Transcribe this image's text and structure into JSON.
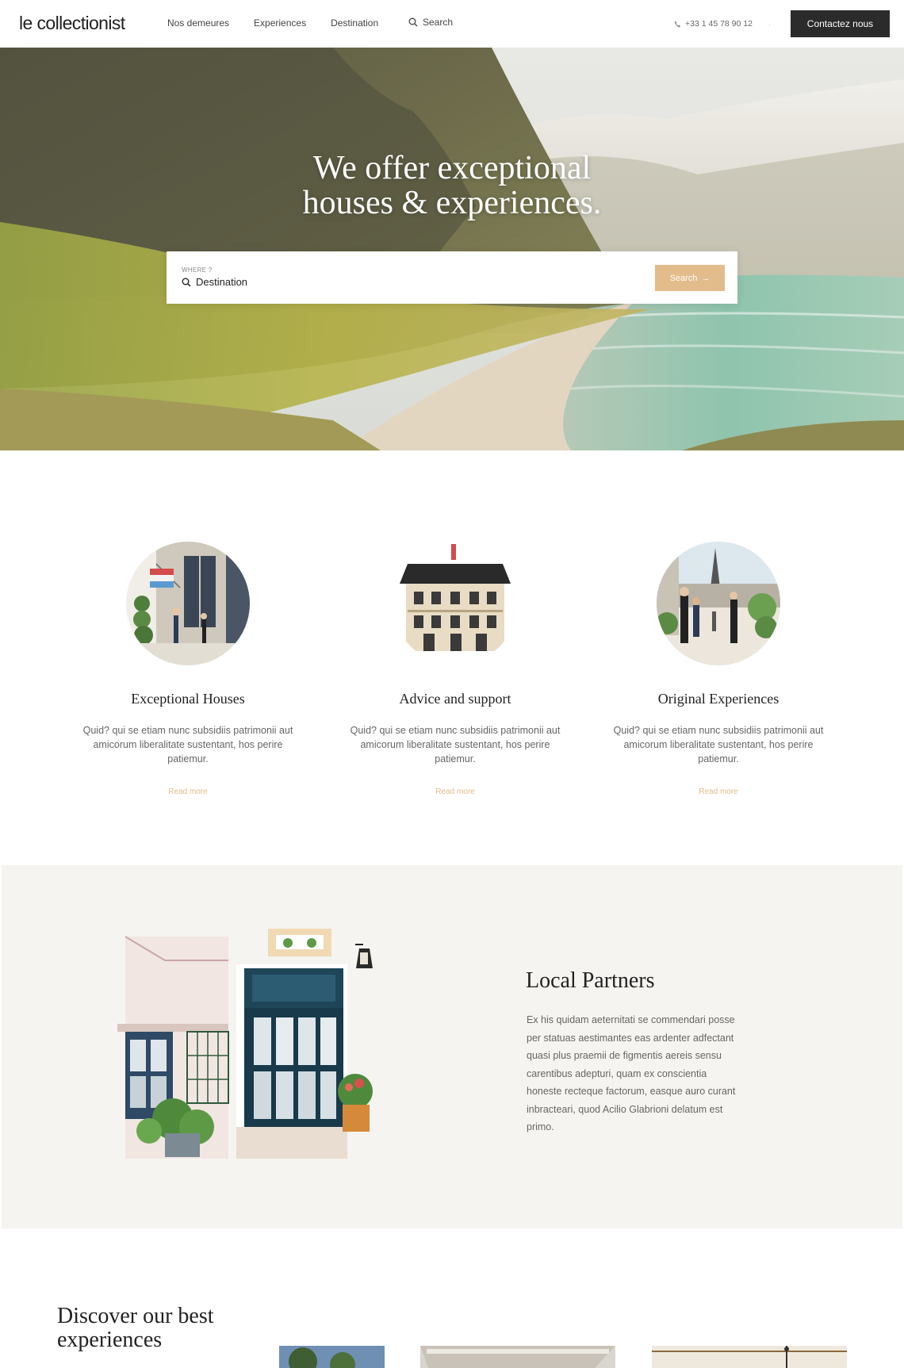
{
  "header": {
    "logo": "le collectionist",
    "nav": [
      "Nos demeures",
      "Experiences",
      "Destination"
    ],
    "search_label": "Search",
    "phone": "+33 1 45 78 90 12",
    "contact_button": "Contactez nous"
  },
  "hero": {
    "title_line1": "We offer exceptional",
    "title_line2": "houses & experiences.",
    "search": {
      "label": "WHERE ?",
      "value": "Destination",
      "button": "Search",
      "button_arrow": "→"
    }
  },
  "features": [
    {
      "title": "Exceptional Houses",
      "text": "Quid? qui se etiam nunc subsidiis patrimonii aut amicorum liberalitate sustentant, hos perire patiemur.",
      "link": "Read more"
    },
    {
      "title": "Advice and support",
      "text": "Quid? qui se etiam nunc subsidiis patrimonii aut amicorum liberalitate sustentant, hos perire patiemur.",
      "link": "Read more"
    },
    {
      "title": "Original Experiences",
      "text": "Quid? qui se etiam nunc subsidiis patrimonii aut amicorum liberalitate sustentant, hos perire patiemur.",
      "link": "Read more"
    }
  ],
  "partners": {
    "title": "Local Partners",
    "text": "Ex his quidam aeternitati se commendari posse per statuas aestimantes eas ardenter adfectant quasi plus praemii de figmentis aereis sensu carentibus adepturi, quam ex conscientia honeste recteque factorum, easque auro curant inbracteari, quod Acilio Glabrioni delatum est primo."
  },
  "discover": {
    "title_line1": "Discover our best",
    "title_line2": "experiences"
  },
  "colors": {
    "accent": "#e3bc8b",
    "dark": "#2b2b2b",
    "section_bg": "#f5f4f0"
  }
}
